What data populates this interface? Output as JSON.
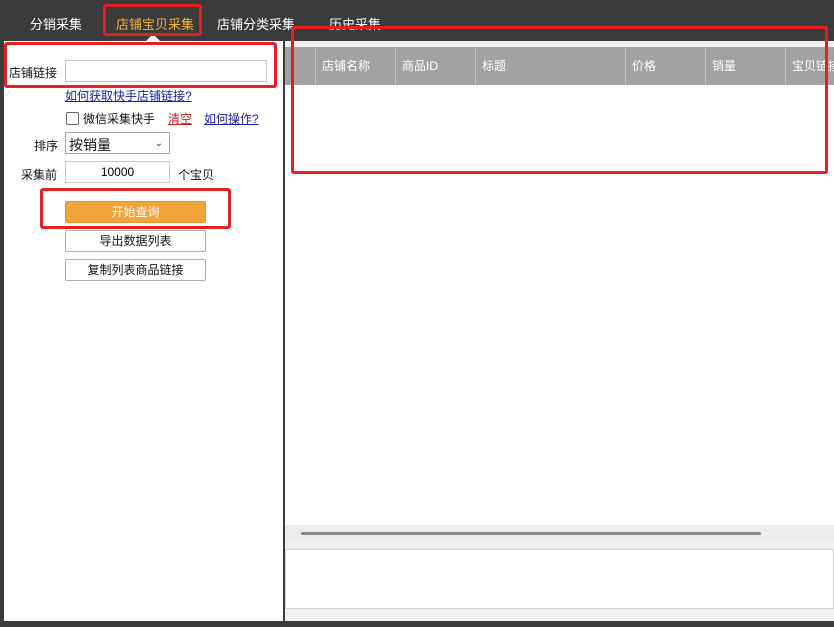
{
  "tabs": [
    {
      "label": "分销采集"
    },
    {
      "label": "店铺宝贝采集"
    },
    {
      "label": "店铺分类采集"
    },
    {
      "label": "历史采集"
    }
  ],
  "active_tab_color": "#f3b23a",
  "form": {
    "shop_link_label": "店铺链接",
    "shop_link_value": "",
    "help_link": "如何获取快手店铺链接?",
    "wechat_checkbox_label": "微信采集快手",
    "wechat_checked": false,
    "clear_link": "清空",
    "howto_link": "如何操作?",
    "sort_label": "排序",
    "sort_value": "按销量",
    "collect_before_label": "采集前",
    "collect_count": "10000",
    "collect_unit": "个宝贝",
    "start_button": "开始查询",
    "export_button": "导出数据列表",
    "copy_button": "复制列表商品链接"
  },
  "table": {
    "columns": [
      "店铺名称",
      "商品ID",
      "标题",
      "价格",
      "销量",
      "宝贝链接"
    ]
  },
  "colors": {
    "accent": "#f2a33a",
    "highlight_box": "#e42020",
    "header_bg": "#a2a2a2"
  }
}
